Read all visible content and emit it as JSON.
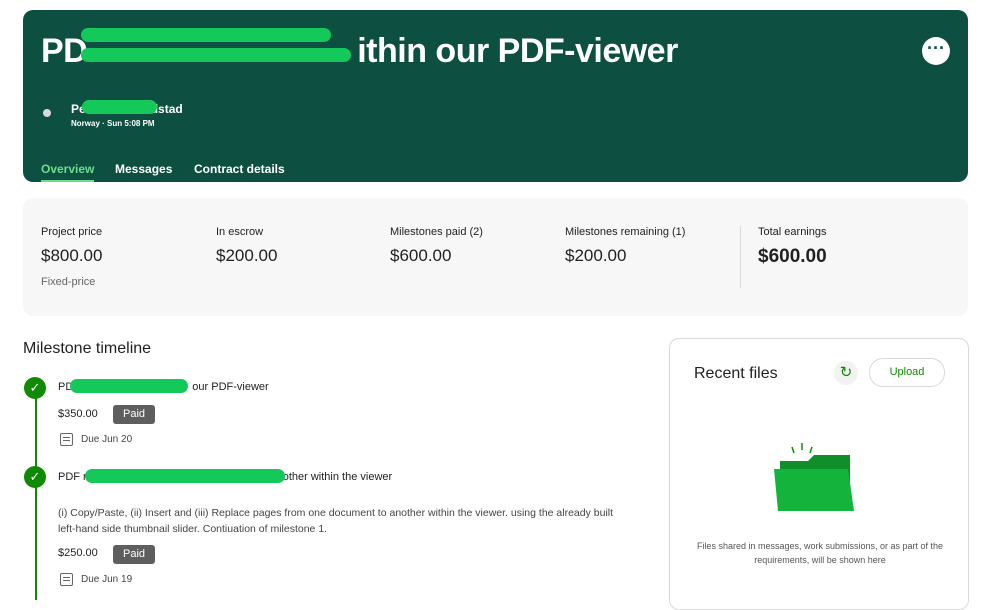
{
  "header": {
    "title_start": "PD",
    "title_end": "ithin our PDF-viewer",
    "menu_label": "···",
    "client_name_start": "Pe",
    "client_name_end": "dstad",
    "client_meta": "Norway · Sun 5:08 PM",
    "tabs": [
      {
        "label": "Overview",
        "active": true
      },
      {
        "label": "Messages",
        "active": false
      },
      {
        "label": "Contract details",
        "active": false
      }
    ]
  },
  "stats": {
    "project_price": {
      "label": "Project price",
      "value": "$800.00",
      "sub": "Fixed-price"
    },
    "in_escrow": {
      "label": "In escrow",
      "value": "$200.00"
    },
    "milestones_paid": {
      "label": "Milestones paid (2)",
      "value": "$600.00"
    },
    "milestones_remaining": {
      "label": "Milestones remaining (1)",
      "value": "$200.00"
    },
    "total_earnings": {
      "label": "Total earnings",
      "value": "$600.00"
    }
  },
  "milestones": {
    "title": "Milestone timeline",
    "items": [
      {
        "name_start": "PD",
        "name_end": "our PDF-viewer",
        "amount": "$350.00",
        "status": "Paid",
        "due": "Due Jun 20"
      },
      {
        "name_start": "PDF r",
        "name_end": "other within the viewer",
        "description": "(i) Copy/Paste, (ii) Insert and (iii) Replace pages from one document to another within the viewer. using the already built left-hand side thumbnail slider. Contiuation of milestone 1.",
        "amount": "$250.00",
        "status": "Paid",
        "due": "Due Jun 19"
      }
    ]
  },
  "files": {
    "title": "Recent files",
    "upload_label": "Upload",
    "empty_text": "Files shared in messages, work submissions, or as part of the requirements, will be shown here"
  },
  "colors": {
    "header_bg": "#0d4f41",
    "accent_green": "#108a00",
    "tab_active": "#6fdc8c",
    "redaction": "#14c85a",
    "badge_bg": "#5e5e5e"
  }
}
